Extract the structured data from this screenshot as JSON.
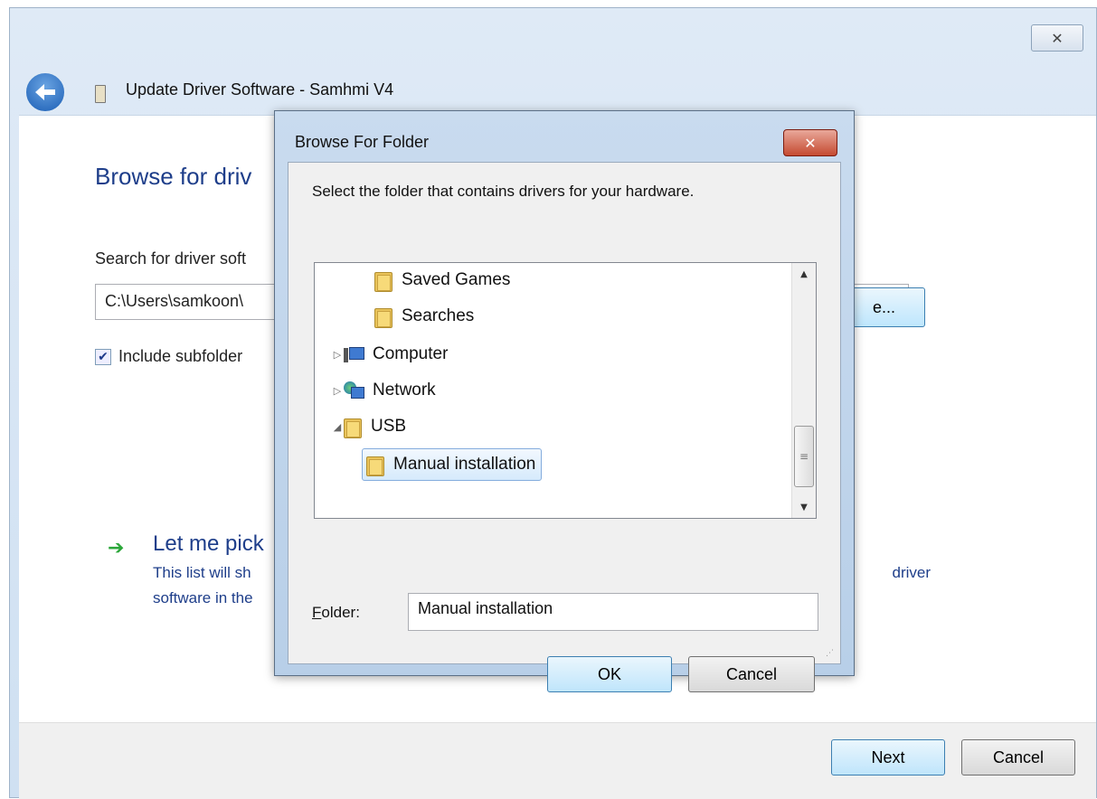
{
  "wizard": {
    "title": "Update Driver Software - Samhmi V4",
    "close_glyph": "✕",
    "heading": "Browse for driv",
    "search_label": "Search for driver soft",
    "path_value": "C:\\Users\\samkoon\\",
    "browse_label": "e...",
    "include_label": "Include subfolder",
    "include_checked": true,
    "letme_title": "Let me pick",
    "letme_line1": "This list will sh",
    "letme_line1_tail": "driver",
    "letme_line2": "software in the",
    "next_label": "Next",
    "cancel_label": "Cancel"
  },
  "dialog": {
    "title": "Browse For Folder",
    "close_glyph": "✕",
    "instruction": "Select the folder that contains drivers for your hardware.",
    "tree": [
      {
        "label": "Saved Games",
        "icon": "folder-icon",
        "expander": ""
      },
      {
        "label": "Searches",
        "icon": "folder-icon",
        "expander": ""
      },
      {
        "label": "Computer",
        "icon": "computer-icon",
        "expander": "▷"
      },
      {
        "label": "Network",
        "icon": "network-icon",
        "expander": "▷"
      },
      {
        "label": "USB",
        "icon": "folder-icon",
        "expander": "◢"
      },
      {
        "label": "Manual installation",
        "icon": "folder-icon",
        "expander": "",
        "selected": true
      }
    ],
    "folder_label_rest": "older:",
    "folder_label_accel": "F",
    "folder_value": "Manual installation",
    "ok_label": "OK",
    "cancel_label": "Cancel"
  }
}
